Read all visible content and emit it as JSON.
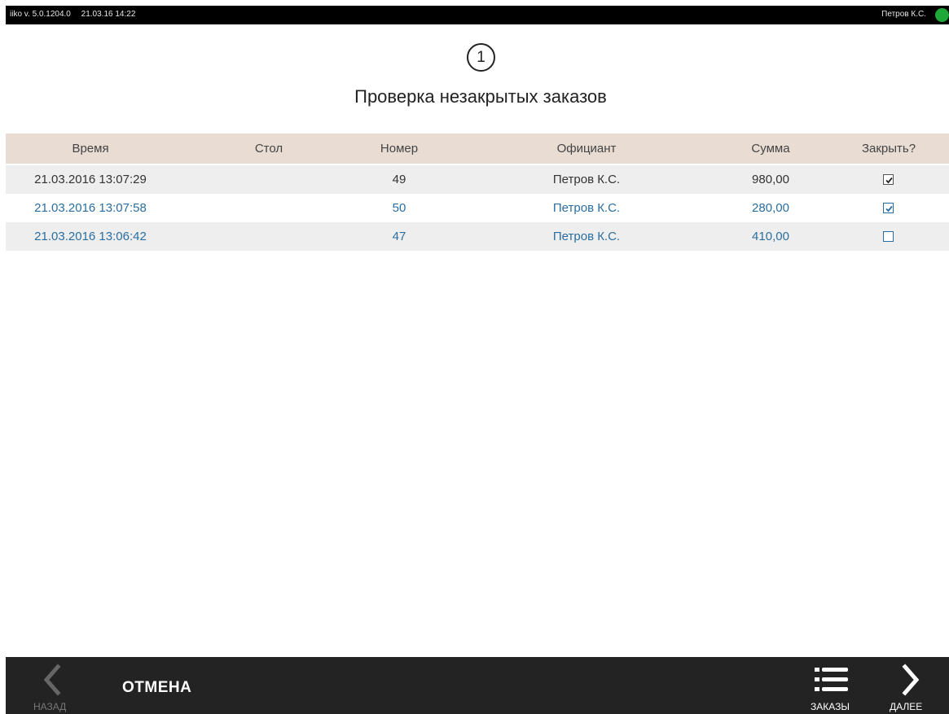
{
  "topbar": {
    "version": "iiko v. 5.0.1204.0",
    "datetime": "21.03.16  14:22",
    "user": "Петров К.С.",
    "status_color": "#1fa83a"
  },
  "step_number": "1",
  "title": "Проверка незакрытых заказов",
  "table": {
    "headers": {
      "time": "Время",
      "table": "Стол",
      "number": "Номер",
      "waiter": "Официант",
      "sum": "Сумма",
      "close": "Закрыть?"
    },
    "rows": [
      {
        "time": "21.03.2016 13:07:29",
        "table": "",
        "number": "49",
        "waiter": "Петров К.С.",
        "sum": "980,00",
        "close": true
      },
      {
        "time": "21.03.2016 13:07:58",
        "table": "",
        "number": "50",
        "waiter": "Петров К.С.",
        "sum": "280,00",
        "close": true
      },
      {
        "time": "21.03.2016 13:06:42",
        "table": "",
        "number": "47",
        "waiter": "Петров К.С.",
        "sum": "410,00",
        "close": false
      }
    ]
  },
  "bottombar": {
    "back_label": "НАЗАД",
    "back_icon": "chevron-left-icon",
    "cancel_label": "ОТМЕНА",
    "orders_label": "ЗАКАЗЫ",
    "orders_icon": "list-icon",
    "next_label": "ДАЛЕЕ",
    "next_icon": "chevron-right-icon"
  },
  "colors": {
    "header_bg": "#e9dcd3",
    "selected_row_text": "#2a6ea1",
    "bottombar_bg": "#232323"
  }
}
